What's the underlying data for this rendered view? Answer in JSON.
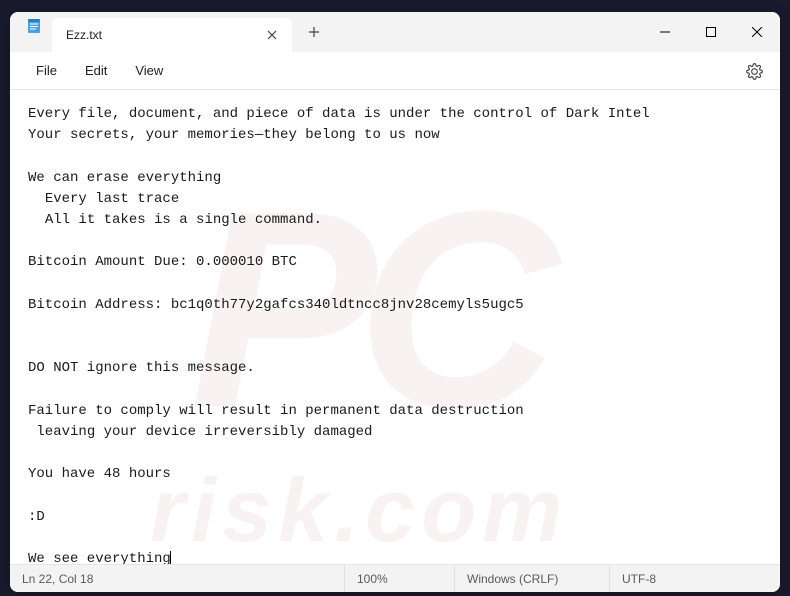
{
  "window": {
    "tab_title": "Ezz.txt",
    "menus": {
      "file": "File",
      "edit": "Edit",
      "view": "View"
    }
  },
  "document": {
    "lines": [
      "Every file, document, and piece of data is under the control of Dark Intel",
      "Your secrets, your memories—they belong to us now",
      "",
      "We can erase everything",
      "  Every last trace",
      "  All it takes is a single command.",
      "",
      "Bitcoin Amount Due: 0.000010 BTC",
      "",
      "Bitcoin Address: bc1q0th77y2gafcs340ldtncc8jnv28cemyls5ugc5",
      "",
      "",
      "DO NOT ignore this message.",
      "",
      "Failure to comply will result in permanent data destruction",
      " leaving your device irreversibly damaged",
      "",
      "You have 48 hours",
      "",
      ":D",
      "",
      "We see everything"
    ]
  },
  "statusbar": {
    "position": "Ln 22, Col 18",
    "zoom": "100%",
    "line_ending": "Windows (CRLF)",
    "encoding": "UTF-8"
  },
  "watermark": {
    "logo": "PC",
    "text": "risk.com"
  }
}
